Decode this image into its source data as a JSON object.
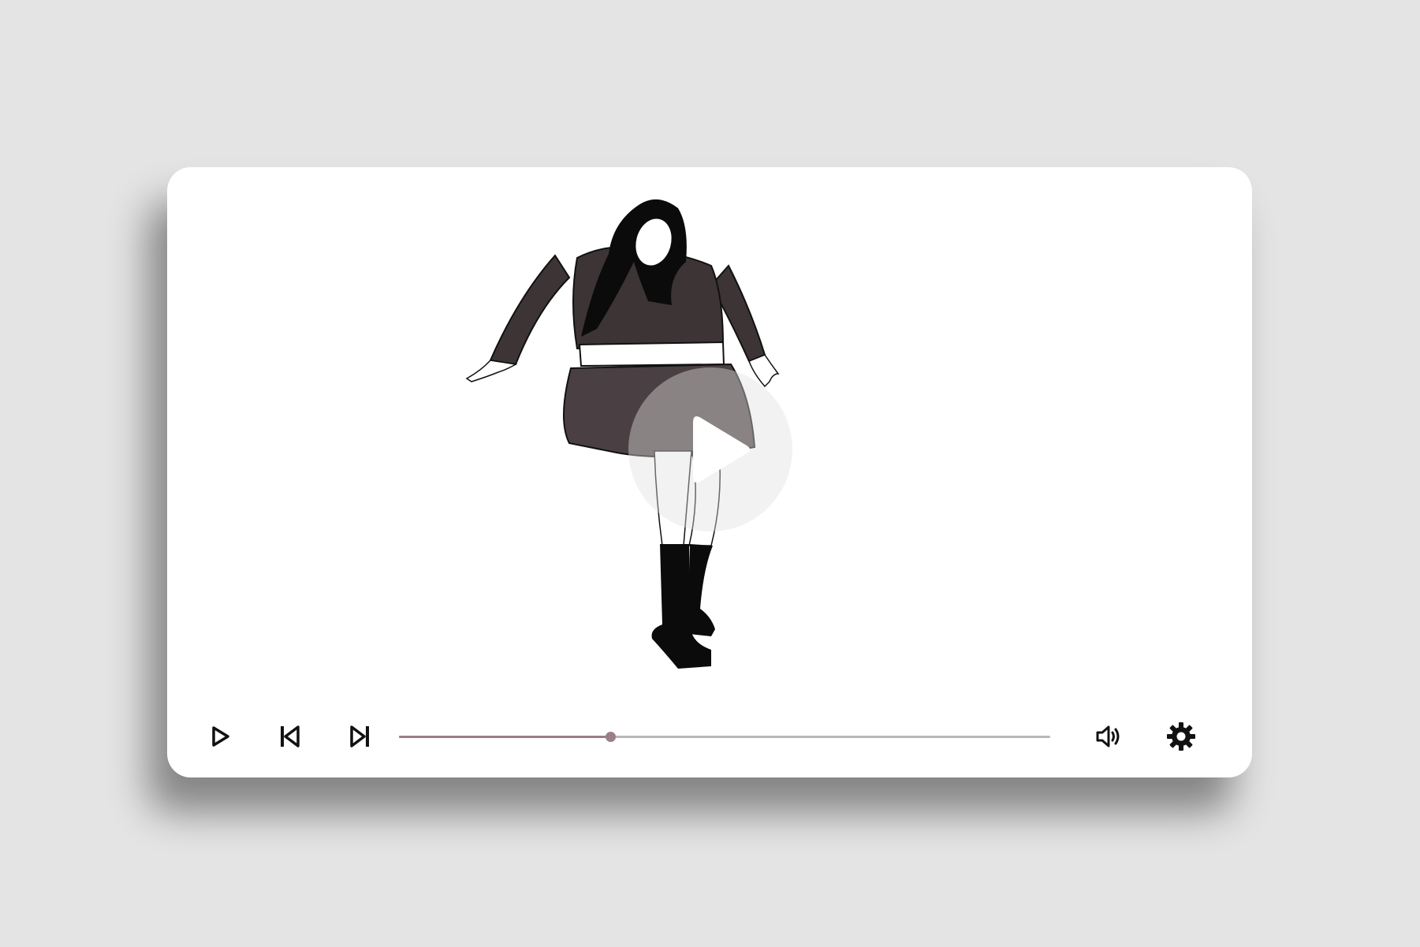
{
  "player": {
    "progress_fraction": 0.325,
    "colors": {
      "page_background": "#e4e4e4",
      "card_background": "#ffffff",
      "progress_played": "#9a7f84",
      "progress_remaining": "#b8b8b8",
      "progress_knob": "#9a7f84",
      "icon": "#111111",
      "jacket": "#3d3435",
      "skirt": "#4a4043",
      "hair_boots": "#0b0b0b"
    },
    "icons": {
      "big_play": "play-icon",
      "play": "play-icon",
      "previous": "skip-previous-icon",
      "next": "skip-next-icon",
      "volume": "volume-icon",
      "settings": "gear-icon"
    }
  }
}
